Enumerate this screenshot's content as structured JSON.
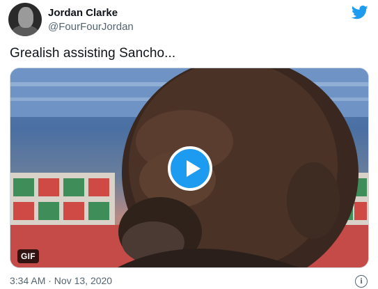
{
  "author": {
    "name": "Jordan Clarke",
    "handle": "@FourFourJordan"
  },
  "tweet": {
    "text": "Grealish assisting Sancho...",
    "timestamp": "3:34 AM · Nov 13, 2020"
  },
  "media": {
    "badge": "GIF"
  },
  "icons": {
    "brand": "twitter-bird-icon",
    "info": "info-icon",
    "play": "play-icon"
  },
  "colors": {
    "accent": "#1d9bf0",
    "text_primary": "#0f1419",
    "text_secondary": "#536471"
  }
}
